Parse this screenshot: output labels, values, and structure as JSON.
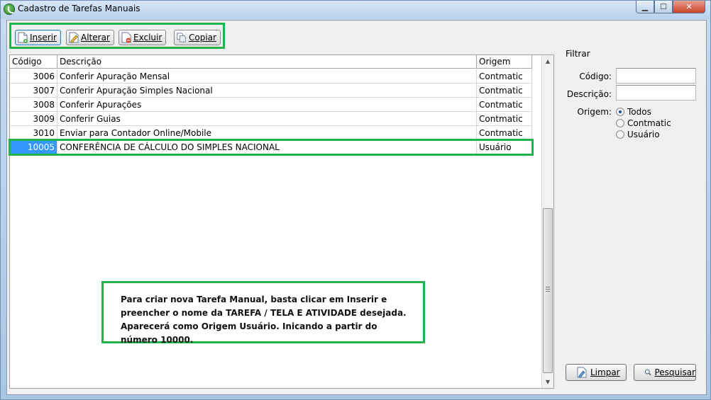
{
  "window": {
    "title": "Cadastro de Tarefas Manuais"
  },
  "toolbar": {
    "insert_label": "Inserir",
    "edit_label": "Alterar",
    "delete_label": "Excluir",
    "copy_label": "Copiar"
  },
  "grid": {
    "columns": [
      "Código",
      "Descrição",
      "Origem"
    ],
    "rows": [
      {
        "code": "3006",
        "description": "Conferir Apuração Mensal",
        "origin": "Contmatic"
      },
      {
        "code": "3007",
        "description": "Conferir Apuração Simples Nacional",
        "origin": "Contmatic"
      },
      {
        "code": "3008",
        "description": "Conferir Apurações",
        "origin": "Contmatic"
      },
      {
        "code": "3009",
        "description": "Conferir Guias",
        "origin": "Contmatic"
      },
      {
        "code": "3010",
        "description": "Enviar para Contador Online/Mobile",
        "origin": "Contmatic"
      },
      {
        "code": "10005",
        "description": "CONFERÊNCIA DE CÁLCULO DO SIMPLES NACIONAL",
        "origin": "Usuário"
      }
    ]
  },
  "annotation": {
    "text": "Para criar nova Tarefa Manual, basta clicar em Inserir e preencher o nome da TAREFA / TELA E ATIVIDADE desejada. Aparecerá como Origem Usuário. Inicando a partir do número 10000."
  },
  "filter": {
    "title": "Filtrar",
    "code_label": "Código:",
    "code_value": "",
    "desc_label": "Descrição:",
    "desc_value": "",
    "origin_label": "Origem:",
    "origin_options": [
      "Todos",
      "Contmatic",
      "Usuário"
    ],
    "clear_label": "Limpar",
    "search_label": "Pesquisar"
  },
  "colors": {
    "highlight": "#22b24c",
    "selection": "#3399ff"
  }
}
